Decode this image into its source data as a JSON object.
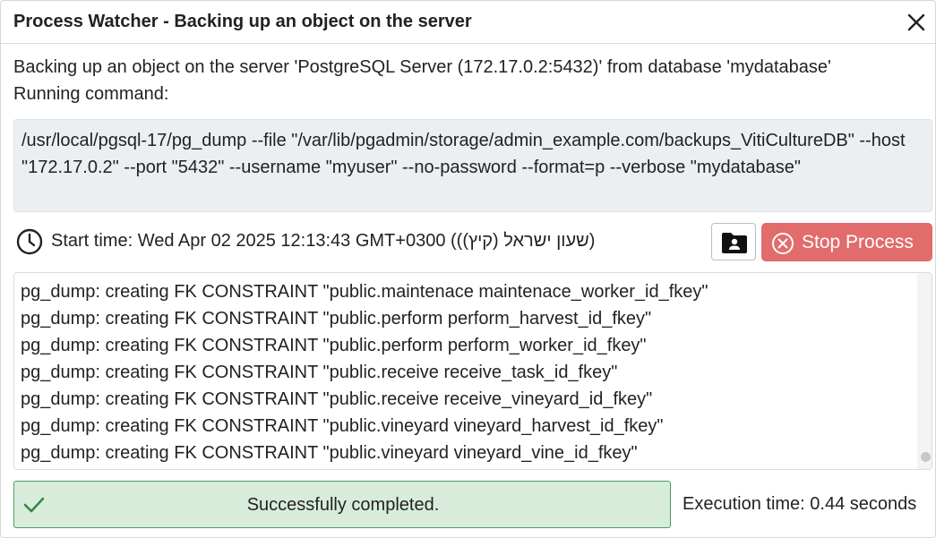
{
  "dialog": {
    "title": "Process Watcher - Backing up an object on the server",
    "description": "Backing up an object on the server 'PostgreSQL Server (172.17.0.2:5432)' from database 'mydatabase'",
    "running_label": "Running command:",
    "command": "/usr/local/pgsql-17/pg_dump --file \"/var/lib/pgadmin/storage/admin_example.com/backups_VitiCultureDB\" --host \"172.17.0.2\" --port \"5432\" --username \"myuser\" --no-password --format=p --verbose \"mydatabase\"",
    "start_time": "Start time: Wed Apr 02 2025 12:13:43 GMT+0300 ((שעון ישראל (קיץ))",
    "stop_button_label": "Stop Process",
    "log_lines": [
      "pg_dump: creating FK CONSTRAINT \"public.maintenace maintenace_worker_id_fkey\"",
      "pg_dump: creating FK CONSTRAINT \"public.perform perform_harvest_id_fkey\"",
      "pg_dump: creating FK CONSTRAINT \"public.perform perform_worker_id_fkey\"",
      "pg_dump: creating FK CONSTRAINT \"public.receive receive_task_id_fkey\"",
      "pg_dump: creating FK CONSTRAINT \"public.receive receive_vineyard_id_fkey\"",
      "pg_dump: creating FK CONSTRAINT \"public.vineyard vineyard_harvest_id_fkey\"",
      "pg_dump: creating FK CONSTRAINT \"public.vineyard vineyard_vine_id_fkey\""
    ],
    "status_text": "Successfully completed.",
    "execution_time": "Execution time: 0.44 seconds"
  },
  "icons": {
    "close": "close-icon",
    "clock": "clock-icon",
    "folder": "folder-user-icon",
    "stop": "stop-circle-icon",
    "check": "check-icon"
  },
  "colors": {
    "stop_button": "#e26b6b",
    "success_bg": "#d8ecdc",
    "success_border": "#4c9a63",
    "command_bg": "#eceff2"
  }
}
